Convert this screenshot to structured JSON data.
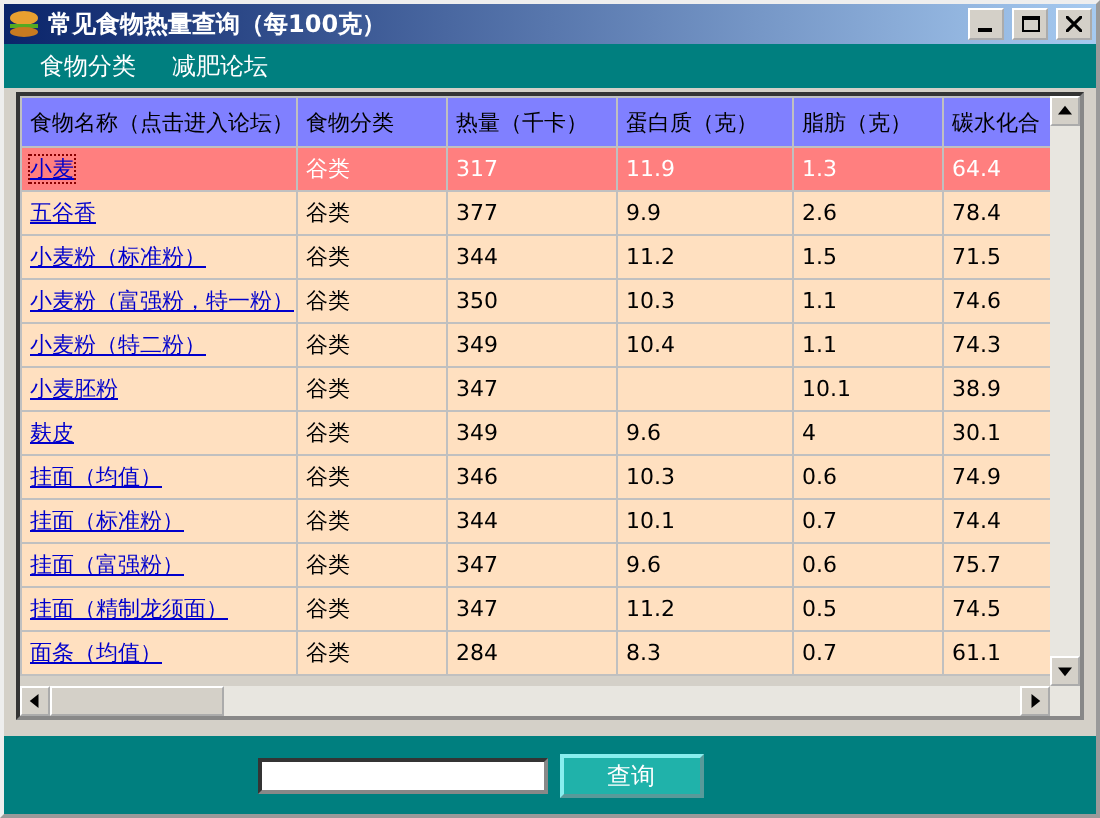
{
  "window": {
    "title": "常见食物热量查询（每100克）"
  },
  "menu": [
    "食物分类",
    "减肥论坛"
  ],
  "table": {
    "columns": [
      "食物名称（点击进入论坛）",
      "食物分类",
      "热量（千卡）",
      "蛋白质（克）",
      "脂肪（克）",
      "碳水化合"
    ],
    "rows": [
      {
        "selected": true,
        "cells": [
          "小麦",
          "谷类",
          "317",
          "11.9",
          "1.3",
          "64.4"
        ]
      },
      {
        "selected": false,
        "cells": [
          "五谷香",
          "谷类",
          "377",
          "9.9",
          "2.6",
          "78.4"
        ]
      },
      {
        "selected": false,
        "cells": [
          "小麦粉（标准粉）",
          "谷类",
          "344",
          "11.2",
          "1.5",
          "71.5"
        ]
      },
      {
        "selected": false,
        "cells": [
          "小麦粉（富强粉，特一粉）",
          "谷类",
          "350",
          "10.3",
          "1.1",
          "74.6"
        ]
      },
      {
        "selected": false,
        "cells": [
          "小麦粉（特二粉）",
          "谷类",
          "349",
          "10.4",
          "1.1",
          "74.3"
        ]
      },
      {
        "selected": false,
        "cells": [
          "小麦胚粉",
          "谷类",
          "347",
          "",
          "10.1",
          "38.9"
        ]
      },
      {
        "selected": false,
        "cells": [
          "麸皮",
          "谷类",
          "349",
          "9.6",
          "4",
          "30.1"
        ]
      },
      {
        "selected": false,
        "cells": [
          "挂面（均值）",
          "谷类",
          "346",
          "10.3",
          "0.6",
          "74.9"
        ]
      },
      {
        "selected": false,
        "cells": [
          "挂面（标准粉）",
          "谷类",
          "344",
          "10.1",
          "0.7",
          "74.4"
        ]
      },
      {
        "selected": false,
        "cells": [
          "挂面（富强粉）",
          "谷类",
          "347",
          "9.6",
          "0.6",
          "75.7"
        ]
      },
      {
        "selected": false,
        "cells": [
          "挂面（精制龙须面）",
          "谷类",
          "347",
          "11.2",
          "0.5",
          "74.5"
        ]
      },
      {
        "selected": false,
        "cells": [
          "面条（均值）",
          "谷类",
          "284",
          "8.3",
          "0.7",
          "61.1"
        ]
      }
    ]
  },
  "search": {
    "button": "查询"
  }
}
